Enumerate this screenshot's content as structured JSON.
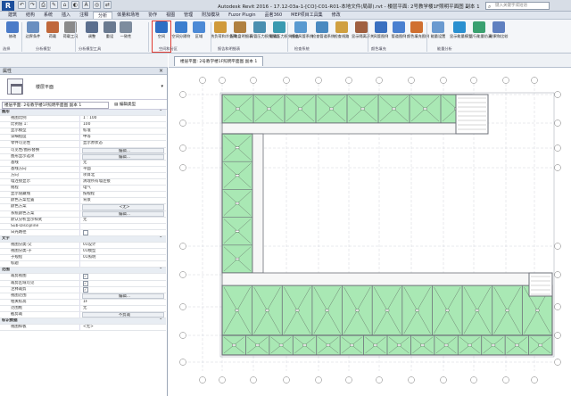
{
  "app": {
    "logo": "R",
    "title": "Autodesk Revit 2016 -     17.12-03a-1-[CO]-C01-R01-本地文件(局部).rvt - 楼层平面: 2号教学楼1F照明平面图 副本 1",
    "help_search_placeholder": "键入关键字或短语",
    "quick_access": [
      "↶",
      "↷",
      "⎙",
      "✎",
      "⌂",
      "◐",
      "A",
      "◎",
      "⇄"
    ]
  },
  "ribbon": {
    "tabs": [
      "建筑",
      "结构",
      "系统",
      "插入",
      "注释",
      "分析",
      "体量和场地",
      "协作",
      "视图",
      "管理",
      "附加模块",
      "Fuzor Plugin",
      "品茗360",
      "MEP项目工具集",
      "修改"
    ],
    "active_tab": "分析",
    "buttons": [
      {
        "label": "修改"
      },
      {
        "label": "边界条件"
      },
      {
        "label": "荷载"
      },
      {
        "label": "荷载工况"
      },
      {
        "label": "调整"
      },
      {
        "label": "重设"
      },
      {
        "label": "一致性"
      },
      {
        "label": "空间"
      },
      {
        "label": "空间分隔符"
      },
      {
        "label": "区域"
      },
      {
        "label": "热负荷和冷负荷"
      },
      {
        "label": "配电盘明细表"
      },
      {
        "label": "风管压力损失报告"
      },
      {
        "label": "管道压力损失报告"
      },
      {
        "label": "检查风管系统"
      },
      {
        "label": "检查管道系统"
      },
      {
        "label": "检查线路"
      },
      {
        "label": "显示隔离开关"
      },
      {
        "label": "风管图例"
      },
      {
        "label": "管道图例"
      },
      {
        "label": "颜色填充图例"
      },
      {
        "label": "能量设置"
      },
      {
        "label": "显示能量模型"
      },
      {
        "label": "运行能量仿真"
      },
      {
        "label": "结果和比较"
      }
    ],
    "groups": [
      "选择",
      "分析模型",
      "分析模型工具",
      "空间和分区",
      "报告和明细表",
      "检查系统",
      "颜色填充",
      "能量分析"
    ]
  },
  "properties": {
    "title": "属性",
    "type_name": "楼层平面",
    "instance_selector": "楼层平面: 2号教学楼1F照明平面图 副本 1",
    "edit_type_label": "编辑类型",
    "rows": [
      {
        "k": "图形",
        "v": "",
        "section": true
      },
      {
        "k": "视图比例",
        "v": "1 : 100"
      },
      {
        "k": "比例值 1:",
        "v": "100"
      },
      {
        "k": "显示模型",
        "v": "标准"
      },
      {
        "k": "详细程度",
        "v": "中等"
      },
      {
        "k": "零件可见性",
        "v": "显示原状态"
      },
      {
        "k": "可见性/图形替换",
        "v": "编辑...",
        "btn": true
      },
      {
        "k": "图形显示选项",
        "v": "编辑...",
        "btn": true
      },
      {
        "k": "基线",
        "v": "无"
      },
      {
        "k": "基线方向",
        "v": "平面"
      },
      {
        "k": "方向",
        "v": "项目北"
      },
      {
        "k": "墙连接显示",
        "v": "清理所有墙连接"
      },
      {
        "k": "规程",
        "v": "电气"
      },
      {
        "k": "显示隐藏线",
        "v": "按规程"
      },
      {
        "k": "颜色方案位置",
        "v": "背景"
      },
      {
        "k": "颜色方案",
        "v": "<无>",
        "btn": true
      },
      {
        "k": "系统颜色方案",
        "v": "编辑...",
        "btn": true
      },
      {
        "k": "默认分析显示样式",
        "v": "无"
      },
      {
        "k": "Sub-Discipline",
        "v": ""
      },
      {
        "k": "日光路径",
        "v": "",
        "chk": true,
        "on": false
      },
      {
        "k": "文字",
        "v": "",
        "section": true
      },
      {
        "k": "视图分类-父",
        "v": "01设计"
      },
      {
        "k": "视图分类-子",
        "v": "01模型"
      },
      {
        "k": "子规程",
        "v": "01照明"
      },
      {
        "k": "标题",
        "v": ""
      },
      {
        "k": "范围",
        "v": "",
        "section": true
      },
      {
        "k": "裁剪视图",
        "v": "",
        "chk": true,
        "on": true
      },
      {
        "k": "裁剪区域可见",
        "v": "",
        "chk": true,
        "on": true
      },
      {
        "k": "注释裁剪",
        "v": "",
        "chk": true,
        "on": true
      },
      {
        "k": "视图范围",
        "v": "编辑...",
        "btn": true
      },
      {
        "k": "相关标高",
        "v": "1F"
      },
      {
        "k": "范围框",
        "v": "无"
      },
      {
        "k": "截剪裁",
        "v": "不剪裁",
        "btn": true
      },
      {
        "k": "标识数据",
        "v": "",
        "section": true
      },
      {
        "k": "视图样板",
        "v": "<无>"
      }
    ]
  },
  "view": {
    "tab_label": "楼层平面: 2号教学楼1F照明平面图 副本 1"
  },
  "colors": {
    "room_fill": "#a9e8b4",
    "wall": "#6d7079",
    "highlight": "#e03b32",
    "ribbon_bg": "#f4f6f9"
  }
}
